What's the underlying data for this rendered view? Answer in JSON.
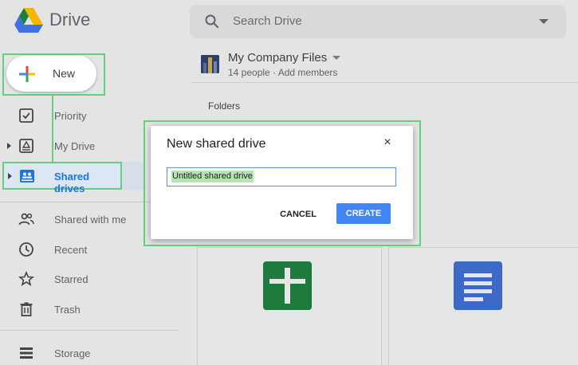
{
  "header": {
    "brand": "Drive",
    "search_placeholder": "Search Drive"
  },
  "new_button": {
    "label": "New"
  },
  "sidebar": {
    "items": [
      {
        "label": "Priority",
        "icon": "checkbox-icon"
      },
      {
        "label": "My Drive",
        "icon": "drive-icon"
      },
      {
        "label": "Shared drives",
        "icon": "shared-drives-icon",
        "active": true
      },
      {
        "label": "Shared with me",
        "icon": "people-icon"
      },
      {
        "label": "Recent",
        "icon": "clock-icon"
      },
      {
        "label": "Starred",
        "icon": "star-icon"
      },
      {
        "label": "Trash",
        "icon": "trash-icon"
      },
      {
        "label": "Storage",
        "icon": "storage-icon"
      }
    ]
  },
  "workspace": {
    "title": "My Company Files",
    "people": "14 people",
    "separator": "·",
    "add_members": "Add members"
  },
  "main": {
    "folders_label": "Folders"
  },
  "dialog": {
    "title": "New shared drive",
    "close": "×",
    "input_value": "Untitled shared drive",
    "cancel_label": "CANCEL",
    "create_label": "CREATE"
  },
  "colors": {
    "accent": "#1a73e8",
    "highlight": "#63d17a",
    "create_button": "#4285f4",
    "sheets": "#1f7a3d",
    "docs": "#3c69c5"
  }
}
